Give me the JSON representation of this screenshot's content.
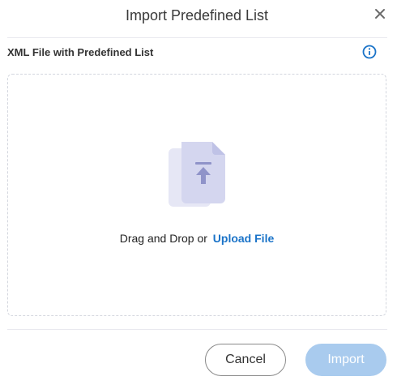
{
  "dialog": {
    "title": "Import Predefined List",
    "close_icon": "close-icon"
  },
  "field": {
    "label": "XML File with Predefined List",
    "info_icon": "info-icon"
  },
  "dropzone": {
    "illustration_icon": "file-upload-icon",
    "drag_text": "Drag and Drop or",
    "upload_link": "Upload File"
  },
  "footer": {
    "cancel_label": "Cancel",
    "import_label": "Import"
  },
  "colors": {
    "accent": "#1a73c8",
    "import_disabled": "#a9cbee",
    "illustration_back": "#e6e7f5",
    "illustration_front": "#d4d6ef",
    "illustration_arrow": "#8f93c9"
  }
}
